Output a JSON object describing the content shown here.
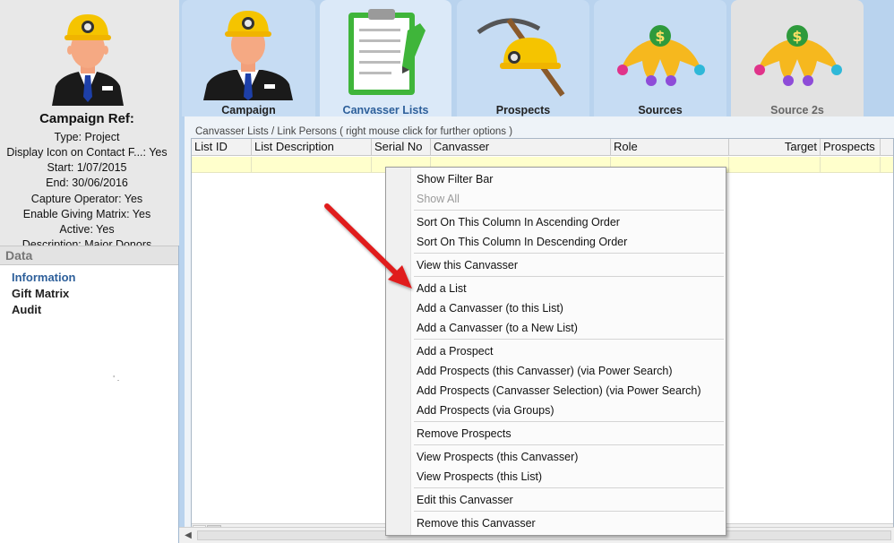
{
  "left_panel": {
    "title": "Campaign Ref:",
    "lines": [
      "Type: Project",
      "Display Icon on Contact F...: Yes",
      "Start:  1/07/2015",
      "End:  30/06/2016",
      "Capture Operator: Yes",
      "Enable Giving Matrix: Yes",
      "Active: Yes",
      "Description: Major Donors"
    ],
    "section_label": "Data",
    "nav": [
      "Information",
      "Gift Matrix",
      "Audit"
    ],
    "active_nav": "Information",
    "mark": "' ."
  },
  "tabs": [
    {
      "label": "Campaign",
      "icon": "miner-person-icon"
    },
    {
      "label": "Canvasser Lists",
      "icon": "clipboard-icon"
    },
    {
      "label": "Prospects",
      "icon": "pickaxe-helmet-icon"
    },
    {
      "label": "Sources",
      "icon": "money-hand-icon"
    },
    {
      "label": "Source 2s",
      "icon": "money-hand-icon"
    }
  ],
  "active_tab": "Canvasser Lists",
  "content": {
    "caption": "Canvasser Lists / Link Persons     (    right mouse click for further options    )",
    "columns": [
      "List ID",
      "List Description",
      "Serial No",
      "Canvasser",
      "Role",
      "Target",
      "Prospects"
    ]
  },
  "context_menu": [
    {
      "label": "Show Filter Bar",
      "enabled": true
    },
    {
      "label": "Show All",
      "enabled": false
    },
    {
      "label": "Sort On This Column In Ascending Order",
      "enabled": true
    },
    {
      "label": "Sort On This Column In Descending Order",
      "enabled": true
    },
    {
      "label": "View this Canvasser",
      "enabled": true
    },
    {
      "label": "Add a List",
      "enabled": true
    },
    {
      "label": "Add a Canvasser (to this List)",
      "enabled": true
    },
    {
      "label": "Add a Canvasser (to a New List)",
      "enabled": true
    },
    {
      "label": "Add a Prospect",
      "enabled": true
    },
    {
      "label": "Add Prospects (this Canvasser) (via Power Search)",
      "enabled": true
    },
    {
      "label": "Add Prospects (Canvasser Selection) (via Power Search)",
      "enabled": true
    },
    {
      "label": "Add Prospects (via Groups)",
      "enabled": true
    },
    {
      "label": "Remove Prospects",
      "enabled": true
    },
    {
      "label": "View Prospects (this Canvasser)",
      "enabled": true
    },
    {
      "label": "View Prospects (this List)",
      "enabled": true
    },
    {
      "label": "Edit this Canvasser",
      "enabled": true
    },
    {
      "label": "Remove this Canvasser",
      "enabled": true
    }
  ],
  "colors": {
    "accent": "#2d5f9a",
    "tab_bg": "#c6dcf3",
    "row_highlight": "#ffffcc",
    "annotation_arrow": "#e01b1b"
  }
}
